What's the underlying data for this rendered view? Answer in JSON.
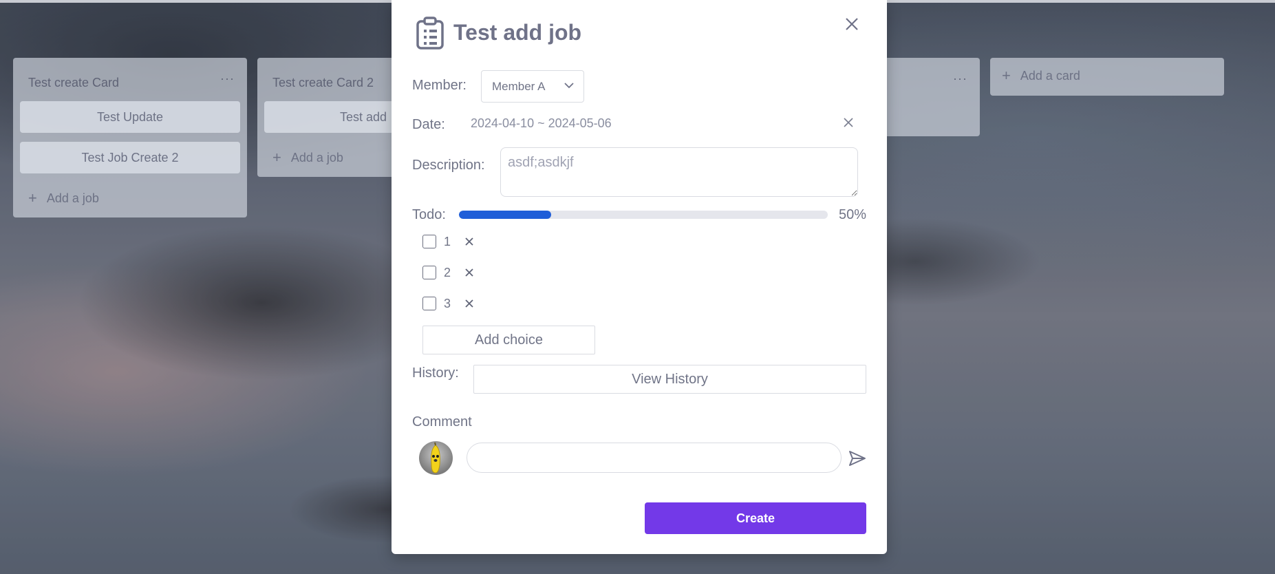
{
  "board": {
    "lists": [
      {
        "title": "Test create Card",
        "menu_icon": "ellipsis-icon",
        "jobs": [
          "Test Update",
          "Test Job Create 2"
        ],
        "add_job_label": "Add a job"
      },
      {
        "title": "Test create Card 2",
        "jobs": [
          "Test add"
        ],
        "add_job_label": "Add a job"
      },
      {
        "menu_icon": "ellipsis-icon"
      }
    ],
    "add_card_label": "Add a card"
  },
  "modal": {
    "title": "Test add job",
    "icon": "clipboard-list-icon",
    "member_label": "Member:",
    "member_value": "Member A",
    "date_label": "Date:",
    "date_value": "2024-04-10 ~ 2024-05-06",
    "description_label": "Description:",
    "description_value": "asdf;asdkjf",
    "todo_label": "Todo:",
    "todo_progress_percent": 25,
    "todo_progress_text": "50%",
    "todos": [
      {
        "text": "1",
        "checked": false
      },
      {
        "text": "2",
        "checked": false
      },
      {
        "text": "3",
        "checked": false
      }
    ],
    "add_choice_label": "Add choice",
    "history_label": "History:",
    "view_history_label": "View History",
    "comment_label": "Comment",
    "comment_value": "",
    "create_label": "Create"
  },
  "colors": {
    "accent": "#7339e8",
    "progress": "#1f5ed8"
  }
}
